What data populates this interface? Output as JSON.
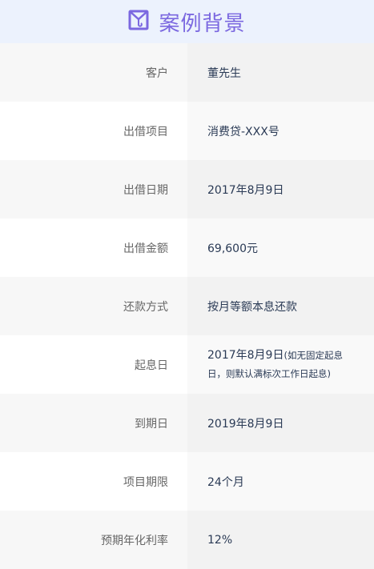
{
  "header": {
    "title": "案例背景",
    "icon": "case-envelope-icon",
    "accent": "#7b68e0"
  },
  "rows": [
    {
      "label": "客户",
      "value": "董先生"
    },
    {
      "label": "出借项目",
      "value": "消费贷-XXX号"
    },
    {
      "label": "出借日期",
      "value": "2017年8月9日"
    },
    {
      "label": "出借金额",
      "value": "69,600元"
    },
    {
      "label": "还款方式",
      "value": "按月等额本息还款"
    },
    {
      "label": "起息日",
      "value": "2017年8月9日",
      "note": "(如无固定起息日，则默认满标次工作日起息)"
    },
    {
      "label": "到期日",
      "value": "2019年8月9日"
    },
    {
      "label": "项目期限",
      "value": "24个月"
    },
    {
      "label": "预期年化利率",
      "value": "12%"
    }
  ]
}
